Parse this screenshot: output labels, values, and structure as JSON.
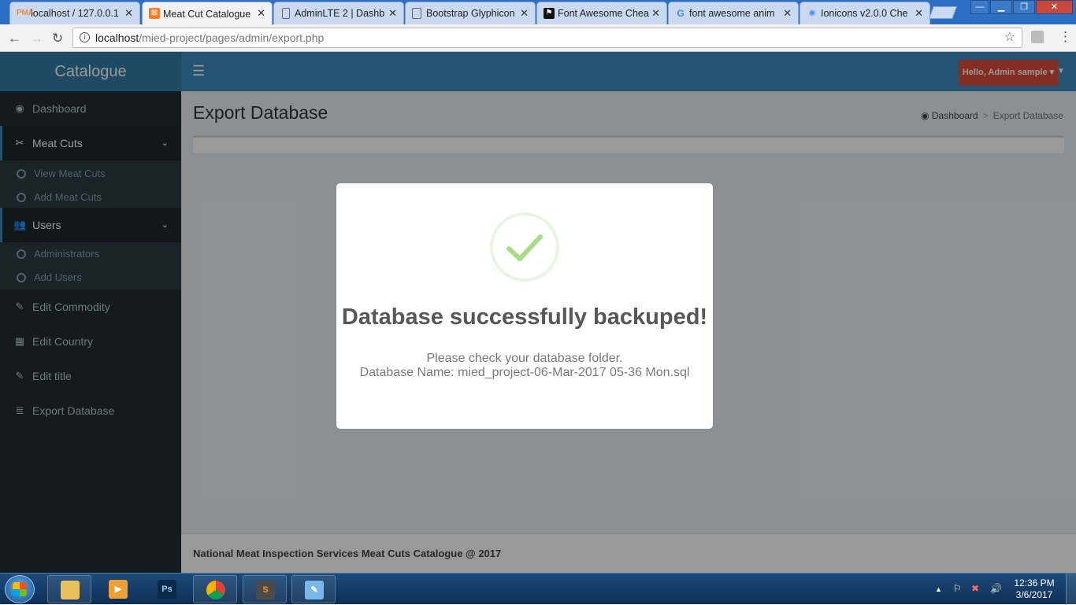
{
  "browser": {
    "tabs": [
      {
        "title": "localhost / 127.0.0.1",
        "icon": "phpmyadmin-icon",
        "active": false
      },
      {
        "title": "Meat Cut Catalogue",
        "icon": "xampp-icon",
        "active": true
      },
      {
        "title": "AdminLTE 2 | Dashb",
        "icon": "page-icon",
        "active": false
      },
      {
        "title": "Bootstrap Glyphicon",
        "icon": "page-icon",
        "active": false
      },
      {
        "title": "Font Awesome Chea",
        "icon": "flag-icon",
        "active": false
      },
      {
        "title": "font awesome anim",
        "icon": "google-icon",
        "active": false
      },
      {
        "title": "Ionicons v2.0.0 Che",
        "icon": "ionicons-icon",
        "active": false
      }
    ],
    "url_host": "localhost",
    "url_path": "/mied-project/pages/admin/export.php"
  },
  "app": {
    "logo": "Catalogue",
    "user_button": "Hello, Admin sample",
    "sidebar": [
      {
        "label": "Dashboard",
        "icon": "dashboard-icon"
      },
      {
        "label": "Meat Cuts",
        "icon": "scissors-icon",
        "open": true,
        "children": [
          "View Meat Cuts",
          "Add Meat Cuts"
        ]
      },
      {
        "label": "Users",
        "icon": "users-icon",
        "open": true,
        "children": [
          "Administrators",
          "Add Users"
        ]
      },
      {
        "label": "Edit Commodity",
        "icon": "pencil-icon"
      },
      {
        "label": "Edit Country",
        "icon": "map-icon"
      },
      {
        "label": "Edit title",
        "icon": "pencil-icon"
      },
      {
        "label": "Export Database",
        "icon": "database-icon"
      }
    ],
    "page_title": "Export Database",
    "breadcrumb": {
      "home": "Dashboard",
      "current": "Export Database"
    },
    "footer": "National Meat Inspection Services Meat Cuts Catalogue @ 2017"
  },
  "modal": {
    "title": "Database successfully backuped!",
    "line1": "Please check your database folder.",
    "line2": "Database Name: mied_project-06-Mar-2017 05-36 Mon.sql",
    "icon": "success-check-icon"
  },
  "taskbar": {
    "apps": [
      "file-explorer-icon",
      "media-player-icon",
      "photoshop-icon",
      "chrome-icon",
      "sublime-text-icon",
      "paint-icon"
    ],
    "time": "12:36 PM",
    "date": "3/6/2017"
  },
  "colors": {
    "header": "#3c8dbc",
    "logo_bg": "#357ca5",
    "sidebar": "#222d32",
    "user_button": "#dd4b39",
    "success": "#a5dc86"
  }
}
